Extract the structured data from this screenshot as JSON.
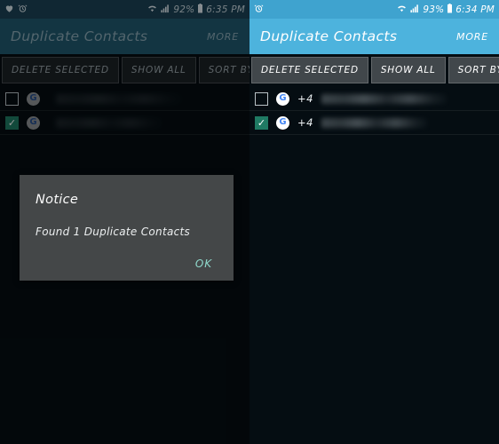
{
  "panels": [
    {
      "id": "left",
      "dimmed": true,
      "colors": {
        "statusbar_bg": "#1c4256",
        "toolbar_bg": "#21596e",
        "body_bg": "#050d12",
        "button_bg": "#1c2226",
        "title_color": "#8aa9b6",
        "status_text": "#c6d6dd",
        "button_text": "#9aa5ab",
        "more_color": "#8aa9b6"
      },
      "statusbar": {
        "left_icons": [
          "heart-icon",
          "alarm-clock-icon"
        ],
        "wifi_icon": "wifi-icon",
        "signal_icon": "signal-bars-icon",
        "battery_percent": "92%",
        "battery_icon": "battery-icon",
        "time": "6:35 PM"
      },
      "toolbar": {
        "title": "Duplicate Contacts",
        "more_label": "MORE"
      },
      "actions": [
        {
          "label": "DELETE SELECTED",
          "name": "delete-selected-button"
        },
        {
          "label": "SHOW ALL",
          "name": "show-all-button"
        },
        {
          "label": "SORT BY NAME",
          "name": "sort-by-name-button"
        }
      ],
      "contacts": [
        {
          "checked": false,
          "account_icon": "google-icon",
          "prefix": "",
          "name_redacted": true
        },
        {
          "checked": true,
          "account_icon": "google-icon",
          "prefix": "",
          "name_redacted": true
        }
      ],
      "dialog": {
        "visible": true,
        "title": "Notice",
        "message": "Found 1 Duplicate Contacts",
        "ok_label": "OK",
        "ok_color": "#8fd8cb",
        "bg": "#444748"
      }
    },
    {
      "id": "right",
      "dimmed": false,
      "colors": {
        "statusbar_bg": "#3fa3cf",
        "toolbar_bg": "#4db3dd",
        "body_bg": "#050d12",
        "button_bg": "#41474b",
        "title_color": "#ffffff",
        "status_text": "#ffffff",
        "button_text": "#ffffff",
        "more_color": "#ffffff"
      },
      "statusbar": {
        "left_icons": [
          "alarm-clock-icon"
        ],
        "wifi_icon": "wifi-icon",
        "signal_icon": "signal-bars-icon",
        "battery_percent": "93%",
        "battery_icon": "battery-icon",
        "time": "6:34 PM"
      },
      "toolbar": {
        "title": "Duplicate Contacts",
        "more_label": "MORE"
      },
      "actions": [
        {
          "label": "DELETE SELECTED",
          "name": "delete-selected-button"
        },
        {
          "label": "SHOW ALL",
          "name": "show-all-button"
        },
        {
          "label": "SORT BY NAME",
          "name": "sort-by-name-button"
        }
      ],
      "contacts": [
        {
          "checked": false,
          "account_icon": "google-icon",
          "prefix": "+4",
          "name_redacted": true
        },
        {
          "checked": true,
          "account_icon": "google-icon",
          "prefix": "+4",
          "name_redacted": true
        }
      ],
      "dialog": {
        "visible": false
      }
    }
  ],
  "glyphs": {
    "checkmark": "✓",
    "google_g": "G",
    "heart": "♥",
    "alarm": "⏰",
    "battery": "█"
  }
}
